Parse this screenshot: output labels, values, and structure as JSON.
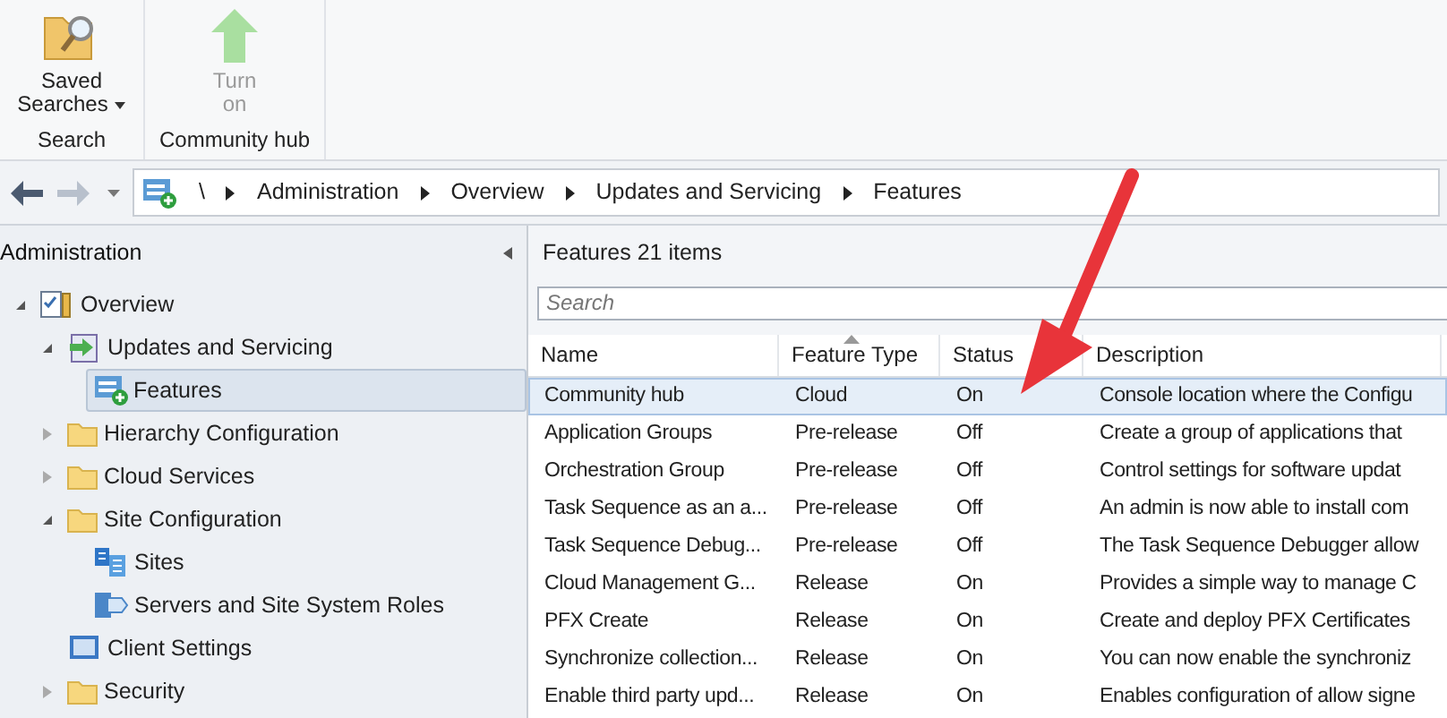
{
  "ribbon": {
    "groups": [
      {
        "label": "Search",
        "buttons": [
          {
            "kind": "search",
            "label": "Saved Searches",
            "disabled": false,
            "dropdown": true
          }
        ]
      },
      {
        "label": "Community hub",
        "buttons": [
          {
            "kind": "turn-on",
            "label": "Turn on",
            "disabled": true,
            "dropdown": false
          }
        ]
      }
    ]
  },
  "nav": {
    "back_disabled": false,
    "forward_disabled": true,
    "breadcrumb": [
      "\\",
      "Administration",
      "Overview",
      "Updates and Servicing",
      "Features"
    ]
  },
  "sidebar": {
    "title": "Administration",
    "items": [
      {
        "label": "Overview",
        "kind": "overview",
        "expanded": true,
        "selected": false,
        "children": [
          {
            "label": "Updates and Servicing",
            "kind": "updates",
            "expanded": true,
            "selected": false,
            "children": [
              {
                "label": "Features",
                "kind": "features",
                "selected": true
              }
            ]
          },
          {
            "label": "Hierarchy Configuration",
            "kind": "folder",
            "expanded": false,
            "selected": false
          },
          {
            "label": "Cloud Services",
            "kind": "folder",
            "expanded": false,
            "selected": false
          },
          {
            "label": "Site Configuration",
            "kind": "folder",
            "expanded": true,
            "selected": false,
            "children": [
              {
                "label": "Sites",
                "kind": "sites",
                "selected": false
              },
              {
                "label": "Servers and Site System Roles",
                "kind": "servers",
                "selected": false
              }
            ]
          },
          {
            "label": "Client Settings",
            "kind": "settings",
            "selected": false
          },
          {
            "label": "Security",
            "kind": "folder",
            "expanded": false,
            "selected": false
          }
        ]
      }
    ]
  },
  "list": {
    "title": "Features",
    "count": "21 items",
    "search": {
      "placeholder": "Search"
    },
    "columns": [
      {
        "label": "Name",
        "sorted": false
      },
      {
        "label": "Feature Type",
        "sorted": true
      },
      {
        "label": "Status",
        "sorted": false
      },
      {
        "label": "Description",
        "sorted": false
      }
    ],
    "rows": [
      {
        "cells": [
          "Community hub",
          "Cloud",
          "On",
          "Console location where the Configu"
        ],
        "selected": true
      },
      {
        "cells": [
          "Application Groups",
          "Pre-release",
          "Off",
          "Create a group of applications that"
        ],
        "selected": false
      },
      {
        "cells": [
          "Orchestration Group",
          "Pre-release",
          "Off",
          "Control settings for software updat"
        ],
        "selected": false
      },
      {
        "cells": [
          "Task Sequence as an a...",
          "Pre-release",
          "Off",
          "An admin is now able to install com"
        ],
        "selected": false
      },
      {
        "cells": [
          "Task Sequence Debug...",
          "Pre-release",
          "Off",
          "The Task Sequence Debugger allow"
        ],
        "selected": false
      },
      {
        "cells": [
          "Cloud Management G...",
          "Release",
          "On",
          "Provides a simple way to manage C"
        ],
        "selected": false
      },
      {
        "cells": [
          "PFX Create",
          "Release",
          "On",
          "Create and deploy PFX Certificates"
        ],
        "selected": false
      },
      {
        "cells": [
          "Synchronize collection...",
          "Release",
          "On",
          "You can now enable the synchroniz"
        ],
        "selected": false
      },
      {
        "cells": [
          "Enable third party upd...",
          "Release",
          "On",
          "Enables configuration of allow signe"
        ],
        "selected": false
      }
    ]
  }
}
